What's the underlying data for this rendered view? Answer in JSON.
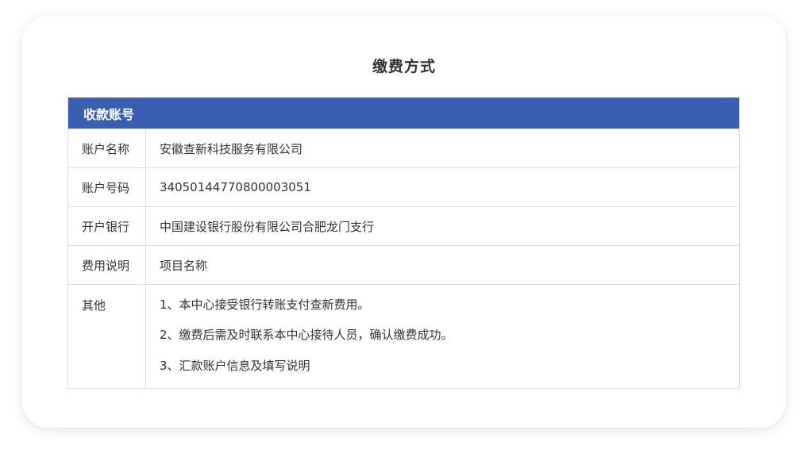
{
  "page": {
    "title": "缴费方式"
  },
  "table": {
    "header": "收款账号",
    "rows": [
      {
        "label": "账户名称",
        "value": "安徽查新科技服务有限公司"
      },
      {
        "label": "账户号码",
        "value": "34050144770800003051"
      },
      {
        "label": "开户银行",
        "value": "中国建设银行股份有限公司合肥龙门支行"
      },
      {
        "label": "费用说明",
        "value": "项目名称"
      }
    ],
    "other": {
      "label": "其他",
      "notes": [
        "1、本中心接受银行转账支付查新费用。",
        "2、缴费后需及时联系本中心接待人员，确认缴费成功。",
        "3、汇款账户信息及填写说明"
      ]
    }
  },
  "colors": {
    "header_bg": "#3b5fb0",
    "border": "#dddddd",
    "text": "#333333"
  }
}
